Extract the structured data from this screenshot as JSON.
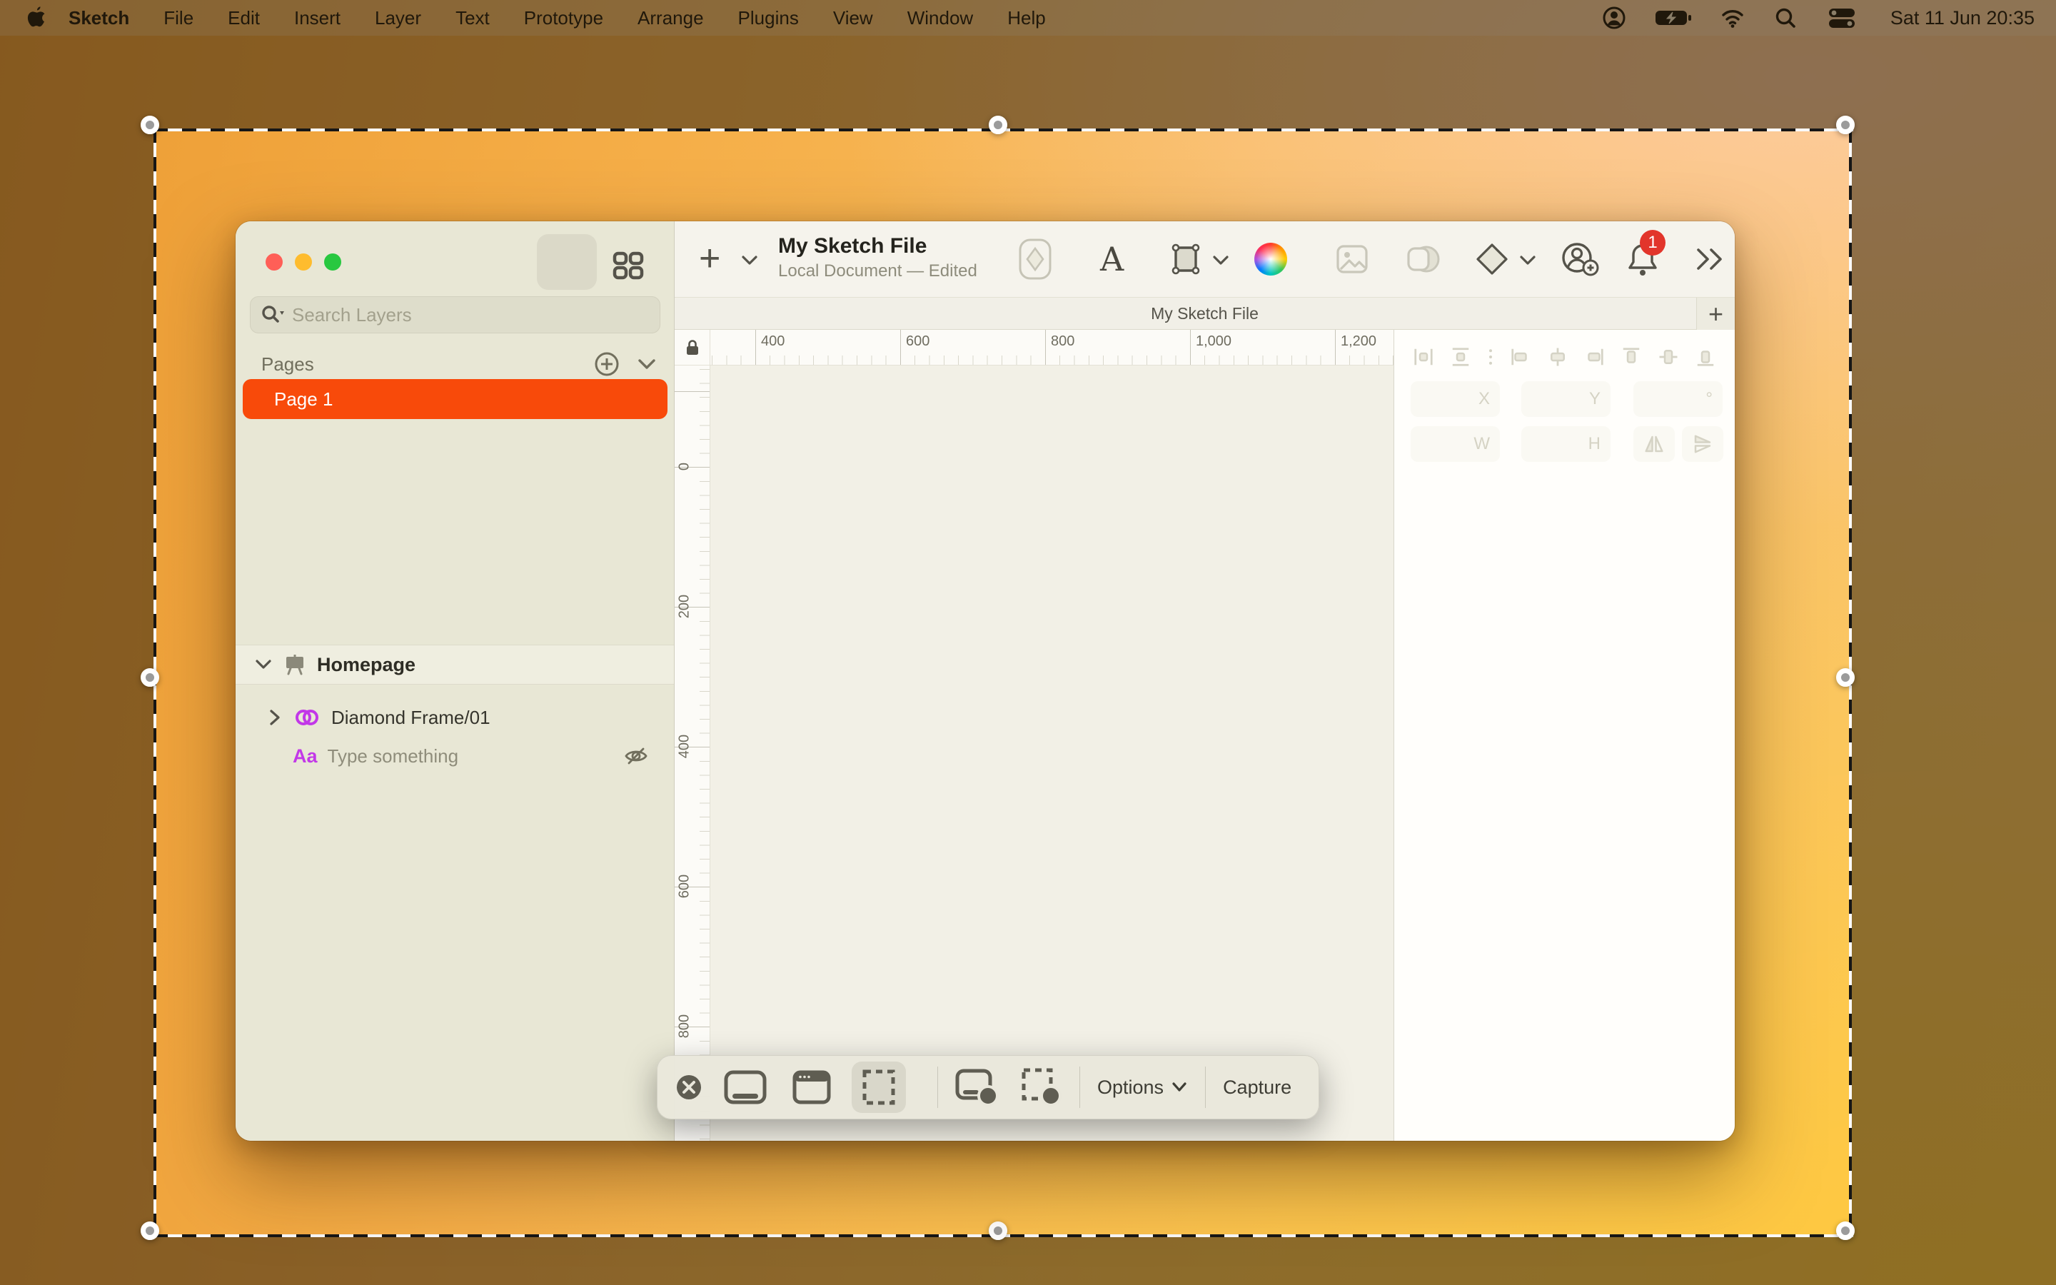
{
  "menu_bar": {
    "app_name": "Sketch",
    "items": [
      "File",
      "Edit",
      "Insert",
      "Layer",
      "Text",
      "Prototype",
      "Arrange",
      "Plugins",
      "View",
      "Window",
      "Help"
    ],
    "clock": "Sat 11 Jun 20:35"
  },
  "glyphs": {
    "plus": "+"
  },
  "window": {
    "toolbar": {
      "title": "My Sketch File",
      "subtitle": "Local Document — Edited",
      "text_tool_glyph": "A",
      "notification_count": "1"
    },
    "tab_label": "My Sketch File",
    "sidebar": {
      "search_placeholder": "Search Layers",
      "pages_header": "Pages",
      "page1": "Page 1",
      "artboard_name": "Homepage",
      "layer_symbol": "Diamond Frame/01",
      "layer_text": "Type something",
      "layer_text_icon": "Aa"
    },
    "canvas": {
      "h_ruler": [
        "400",
        "600",
        "800",
        "1,000",
        "1,200"
      ],
      "v_ruler": [
        "0",
        "200",
        "400",
        "600",
        "800"
      ]
    },
    "inspector": {
      "x_label": "X",
      "y_label": "Y",
      "rotation_label": "°",
      "w_label": "W",
      "h_label": "H"
    }
  },
  "capture_toolbar": {
    "options_label": "Options",
    "capture_label": "Capture"
  },
  "colors": {
    "accent_orange": "#F84A0A",
    "badge_red": "#E2352B",
    "symbol_magenta": "#C238E8",
    "traffic_red": "#FF5F57",
    "traffic_yellow": "#FEBC2E",
    "traffic_green": "#28C840"
  }
}
